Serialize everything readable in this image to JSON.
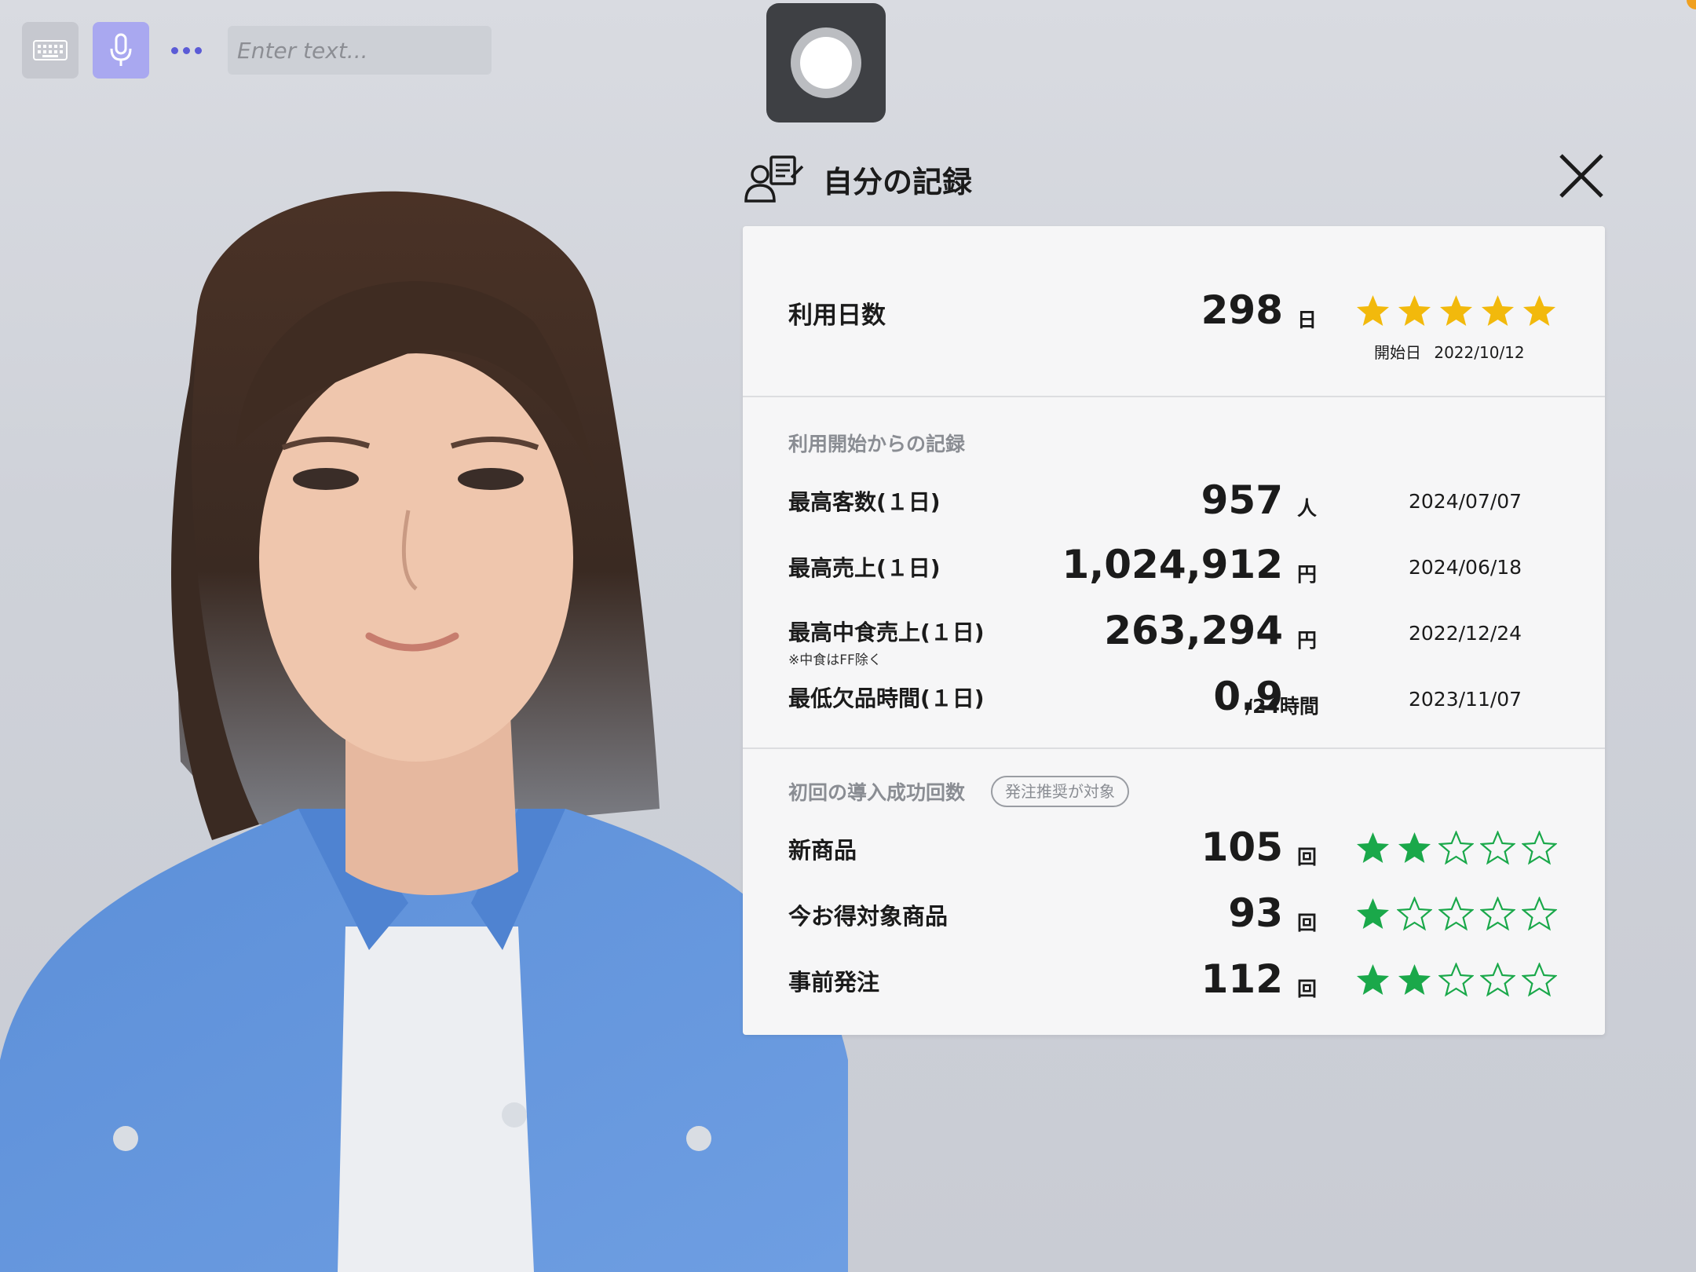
{
  "toolbar": {
    "placeholder": "Enter text..."
  },
  "panel": {
    "title": "自分の記録"
  },
  "usage": {
    "label": "利用日数",
    "value": "298",
    "unit": "日",
    "rating": 5,
    "rating_max": 5,
    "start_label": "開始日",
    "start_date": "2022/10/12",
    "star_color": "#f2b90c"
  },
  "records": {
    "section_title": "利用開始からの記録",
    "items": [
      {
        "label": "最高客数(１日)",
        "value": "957",
        "unit": "人",
        "date": "2024/07/07"
      },
      {
        "label": "最高売上(１日)",
        "value": "1,024,912",
        "unit": "円",
        "date": "2024/06/18"
      },
      {
        "label": "最高中食売上(１日)",
        "note": "※中食はFF除く",
        "value": "263,294",
        "unit": "円",
        "date": "2022/12/24"
      },
      {
        "label": "最低欠品時間(１日)",
        "value": "0.9",
        "unit": "/24時間",
        "date": "2023/11/07"
      }
    ]
  },
  "success": {
    "section_title": "初回の導入成功回数",
    "badge": "発注推奨が対象",
    "star_color": "#1aa84a",
    "items": [
      {
        "label": "新商品",
        "value": "105",
        "unit": "回",
        "rating": 2
      },
      {
        "label": "今お得対象商品",
        "value": "93",
        "unit": "回",
        "rating": 1
      },
      {
        "label": "事前発注",
        "value": "112",
        "unit": "回",
        "rating": 2
      }
    ],
    "rating_max": 5
  }
}
